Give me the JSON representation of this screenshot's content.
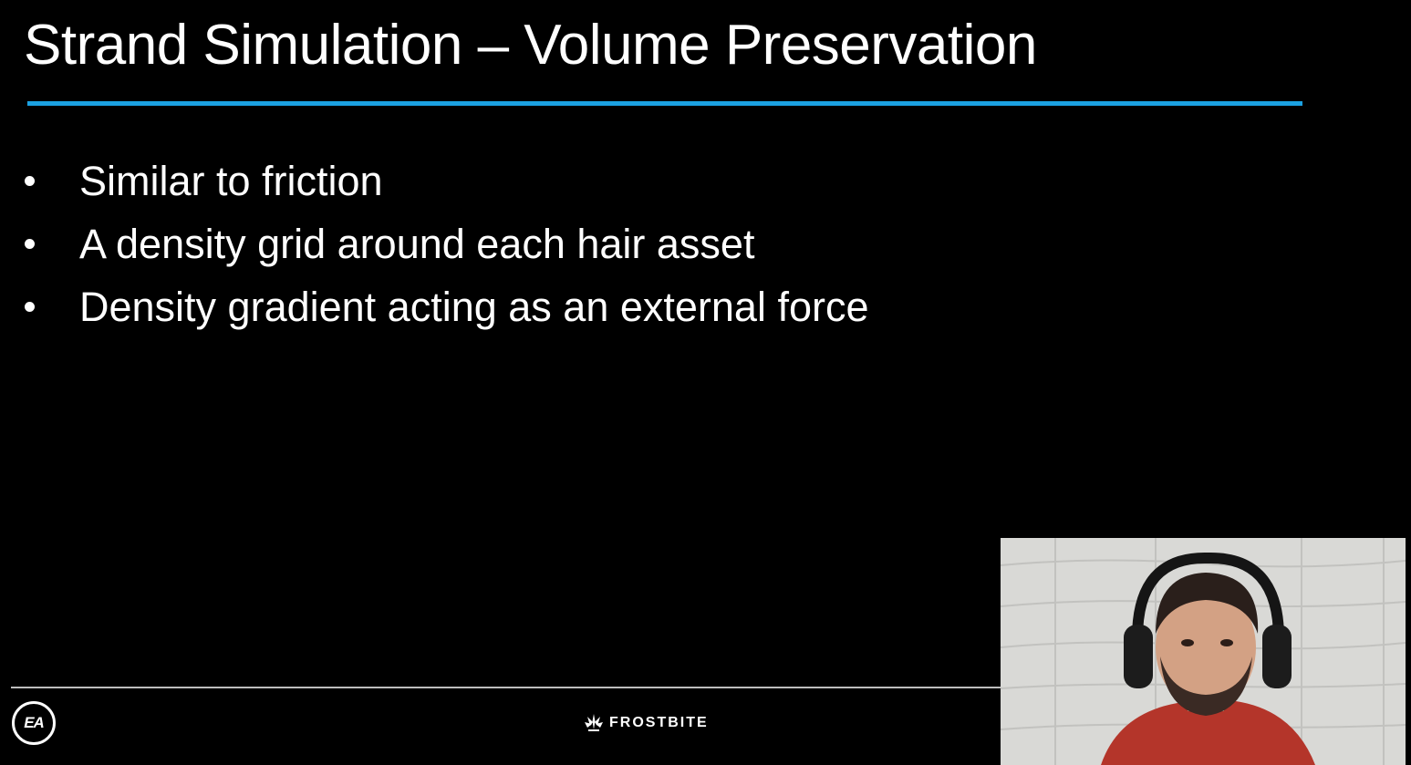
{
  "slide": {
    "title": "Strand Simulation – Volume Preservation",
    "bullets": [
      "Similar to friction",
      "A density grid around each hair asset",
      "Density gradient acting as an external force"
    ],
    "accent_color": "#1ba1e2"
  },
  "footer": {
    "left_logo": "EA",
    "center_logo": "FROSTBITE"
  },
  "webcam": {
    "subject": "presenter with headset"
  }
}
